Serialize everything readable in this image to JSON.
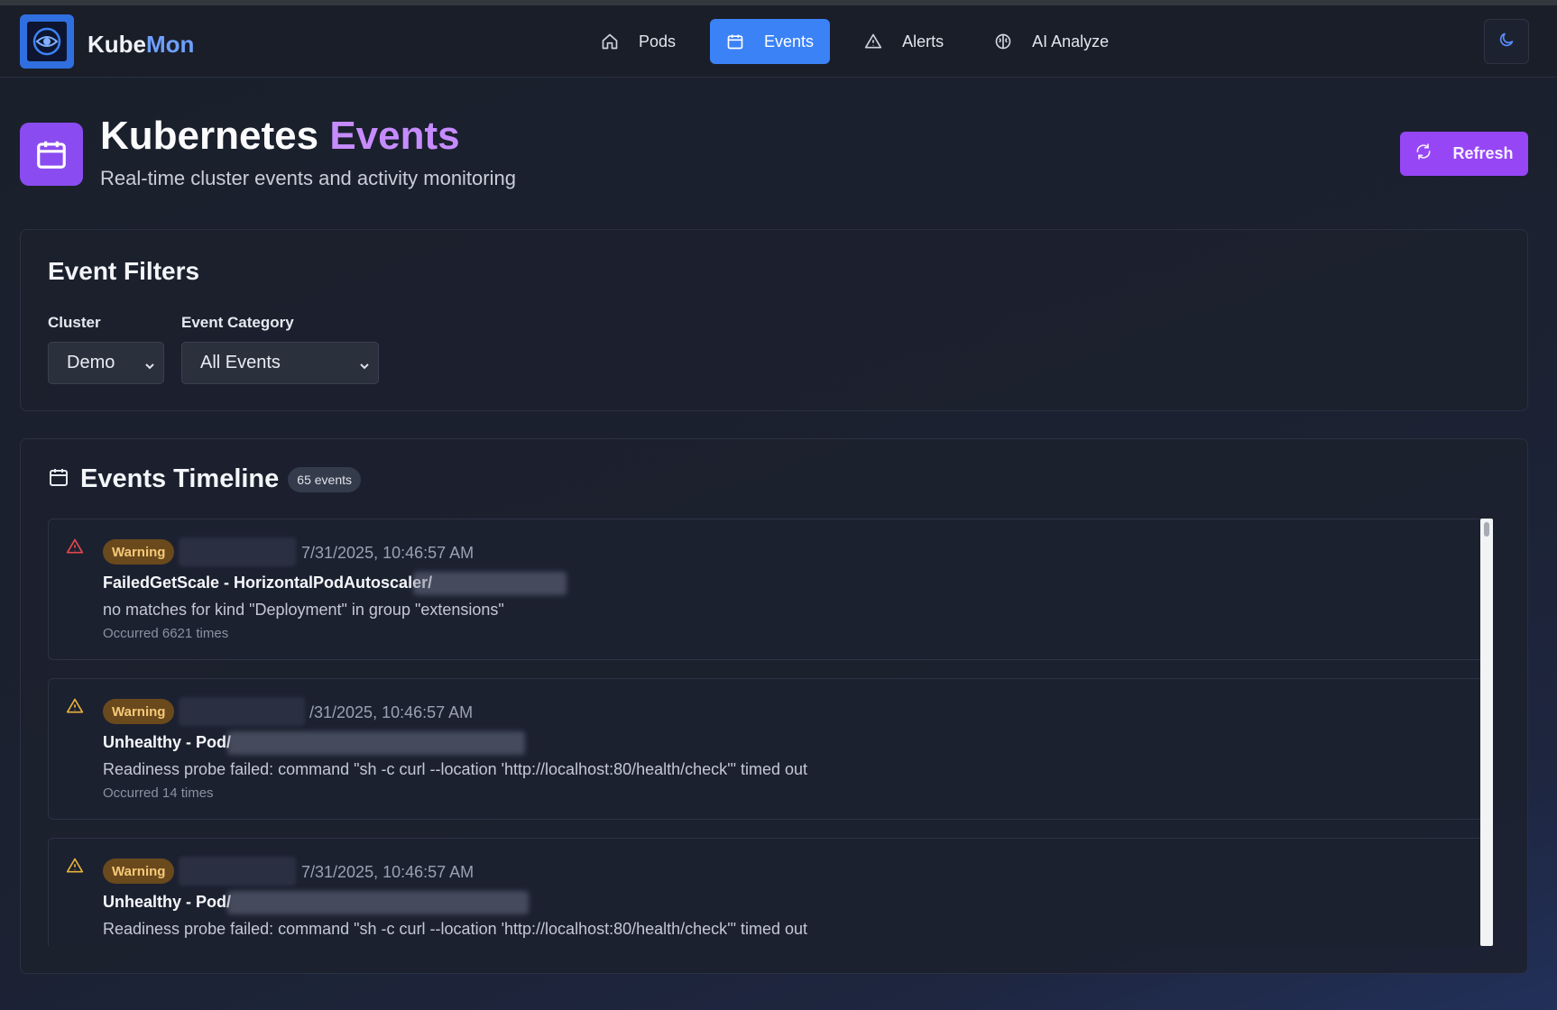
{
  "app": {
    "brand_main": "Kube",
    "brand_accent": "Mon"
  },
  "nav": {
    "items": [
      {
        "label": "Pods",
        "icon": "home-icon",
        "active": false
      },
      {
        "label": "Events",
        "icon": "calendar-icon",
        "active": true
      },
      {
        "label": "Alerts",
        "icon": "warning-triangle-icon",
        "active": false
      },
      {
        "label": "AI Analyze",
        "icon": "brain-icon",
        "active": false
      }
    ],
    "theme_toggle_icon": "moon-icon"
  },
  "header": {
    "title_main": "Kubernetes",
    "title_accent": "Events",
    "subtitle": "Real-time cluster events and activity monitoring",
    "refresh_label": "Refresh"
  },
  "filters": {
    "title": "Event Filters",
    "cluster_label": "Cluster",
    "cluster_value": "Demo",
    "category_label": "Event Category",
    "category_value": "All Events"
  },
  "timeline": {
    "title": "Events Timeline",
    "count": "65 events",
    "events": [
      {
        "level": "Warning",
        "icon_color": "#e5484d",
        "timestamp": "7/31/2025, 10:46:57 AM",
        "title": "FailedGetScale - HorizontalPodAutoscaler/",
        "message": "no matches for kind \"Deployment\" in group \"extensions\"",
        "occurrences": "Occurred 6621 times"
      },
      {
        "level": "Warning",
        "icon_color": "#e8b23a",
        "timestamp": "/31/2025, 10:46:57 AM",
        "title": "Unhealthy - Pod/",
        "message": "Readiness probe failed: command \"sh -c curl --location 'http://localhost:80/health/check'\" timed out",
        "occurrences": "Occurred 14 times"
      },
      {
        "level": "Warning",
        "icon_color": "#e8b23a",
        "timestamp": "7/31/2025, 10:46:57 AM",
        "title": "Unhealthy - Pod/",
        "message": "Readiness probe failed: command \"sh -c curl --location 'http://localhost:80/health/check'\" timed out",
        "occurrences": ""
      }
    ]
  }
}
